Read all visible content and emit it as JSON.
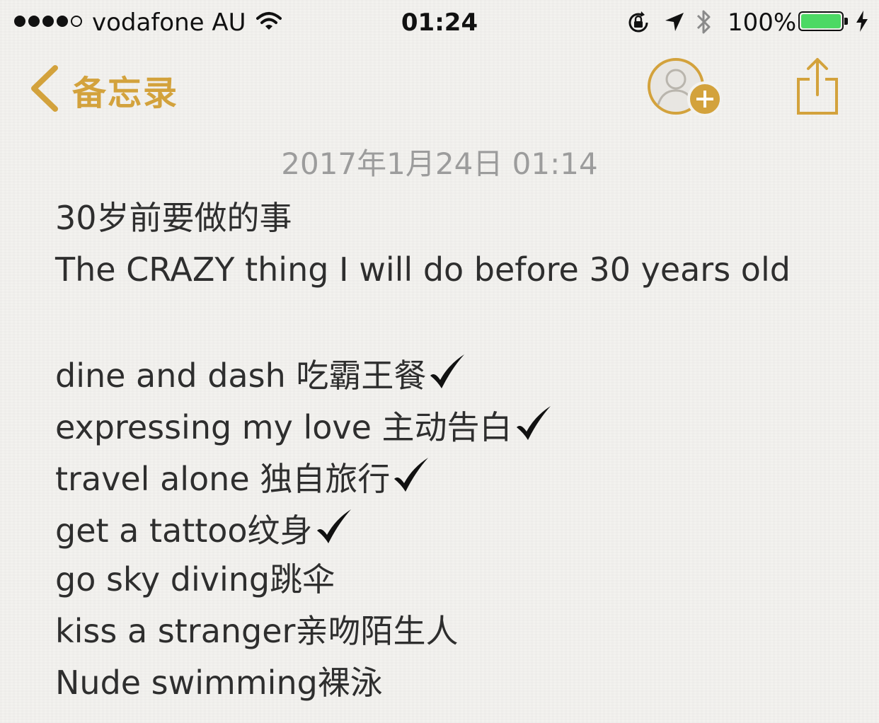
{
  "status_bar": {
    "carrier": "vodafone AU",
    "time": "01:24",
    "battery_percent": "100%",
    "signal_bars": 4,
    "signal_max": 5,
    "battery_level": 1.0,
    "battery_color": "#4cd964"
  },
  "nav": {
    "back_label": "备忘录",
    "accent_color": "#d3a23c",
    "icons": [
      "chevron-left-icon",
      "add-person-icon",
      "share-icon"
    ]
  },
  "note": {
    "date": "2017年1月24日 01:14",
    "lines": [
      {
        "text": "30岁前要做的事",
        "checked": false
      },
      {
        "text": "The CRAZY thing I will do before 30 years old",
        "checked": false
      },
      {
        "text": "",
        "checked": false
      },
      {
        "text": "dine and dash 吃霸王餐",
        "checked": true
      },
      {
        "text": "expressing my love 主动告白",
        "checked": true
      },
      {
        "text": "travel alone 独自旅行",
        "checked": true
      },
      {
        "text": "get a tattoo纹身",
        "checked": true
      },
      {
        "text": "go sky diving跳伞",
        "checked": false
      },
      {
        "text": "kiss a stranger亲吻陌生人",
        "checked": false
      },
      {
        "text": "Nude swimming裸泳",
        "checked": false
      }
    ]
  }
}
